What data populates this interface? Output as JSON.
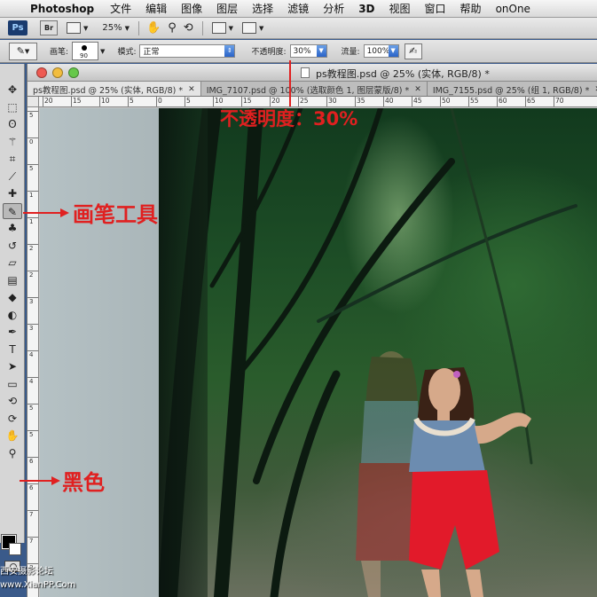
{
  "menubar": {
    "app_name": "Photoshop",
    "items": [
      "文件",
      "编辑",
      "图像",
      "图层",
      "选择",
      "滤镜",
      "分析",
      "3D",
      "视图",
      "窗口",
      "帮助",
      "onOne"
    ]
  },
  "appbar": {
    "logo": "Ps",
    "bridge": "Br",
    "zoom": "25%"
  },
  "options": {
    "brush_label": "画笔:",
    "brush_size": "90",
    "mode_label": "模式:",
    "mode_value": "正常",
    "opacity_label": "不透明度:",
    "opacity_value": "30%",
    "flow_label": "流量:",
    "flow_value": "100%"
  },
  "document": {
    "title": "ps教程图.psd @ 25% (实体, RGB/8) *",
    "tabs": [
      "ps教程图.psd @ 25% (实体, RGB/8) *",
      "IMG_7107.psd @ 100% (选取颜色 1, 图层蒙版/8) *",
      "IMG_7155.psd @ 25% (组 1, RGB/8) *"
    ],
    "ruler_h": [
      "20",
      "15",
      "10",
      "5",
      "0",
      "5",
      "10",
      "15",
      "20",
      "25",
      "30",
      "35",
      "40",
      "45",
      "50",
      "55",
      "60",
      "65",
      "70"
    ],
    "ruler_v": [
      "5",
      "0",
      "5",
      "1",
      "1",
      "2",
      "2",
      "3",
      "3",
      "4",
      "4",
      "5",
      "5",
      "6",
      "6",
      "7",
      "7",
      "8"
    ]
  },
  "tools": [
    {
      "name": "move-tool-icon",
      "glyph": "✥"
    },
    {
      "name": "marquee-tool-icon",
      "glyph": "⬚"
    },
    {
      "name": "lasso-tool-icon",
      "glyph": "ʘ"
    },
    {
      "name": "magic-wand-tool-icon",
      "glyph": "⚚"
    },
    {
      "name": "crop-tool-icon",
      "glyph": "⌗"
    },
    {
      "name": "eyedropper-tool-icon",
      "glyph": "⟋"
    },
    {
      "name": "healing-brush-tool-icon",
      "glyph": "✚"
    },
    {
      "name": "brush-tool-icon",
      "glyph": "✎"
    },
    {
      "name": "clone-stamp-tool-icon",
      "glyph": "♣"
    },
    {
      "name": "history-brush-tool-icon",
      "glyph": "↺"
    },
    {
      "name": "eraser-tool-icon",
      "glyph": "▱"
    },
    {
      "name": "gradient-tool-icon",
      "glyph": "▤"
    },
    {
      "name": "blur-tool-icon",
      "glyph": "◆"
    },
    {
      "name": "dodge-tool-icon",
      "glyph": "◐"
    },
    {
      "name": "pen-tool-icon",
      "glyph": "✒"
    },
    {
      "name": "type-tool-icon",
      "glyph": "T"
    },
    {
      "name": "path-selection-tool-icon",
      "glyph": "➤"
    },
    {
      "name": "shape-tool-icon",
      "glyph": "▭"
    },
    {
      "name": "3d-rotate-tool-icon",
      "glyph": "⟲"
    },
    {
      "name": "3d-orbit-tool-icon",
      "glyph": "⟳"
    },
    {
      "name": "hand-tool-icon",
      "glyph": "✋"
    },
    {
      "name": "zoom-tool-icon",
      "glyph": "⚲"
    }
  ],
  "annotations": {
    "opacity_note": "不透明度：30%",
    "brush_note": "画笔工具",
    "color_note": "黑色"
  },
  "watermark": {
    "line1": "西安摄影论坛",
    "line2": "www.XianPP.Com"
  },
  "colors": {
    "annotation": "#e02020",
    "foreground_swatch": "#000000"
  }
}
